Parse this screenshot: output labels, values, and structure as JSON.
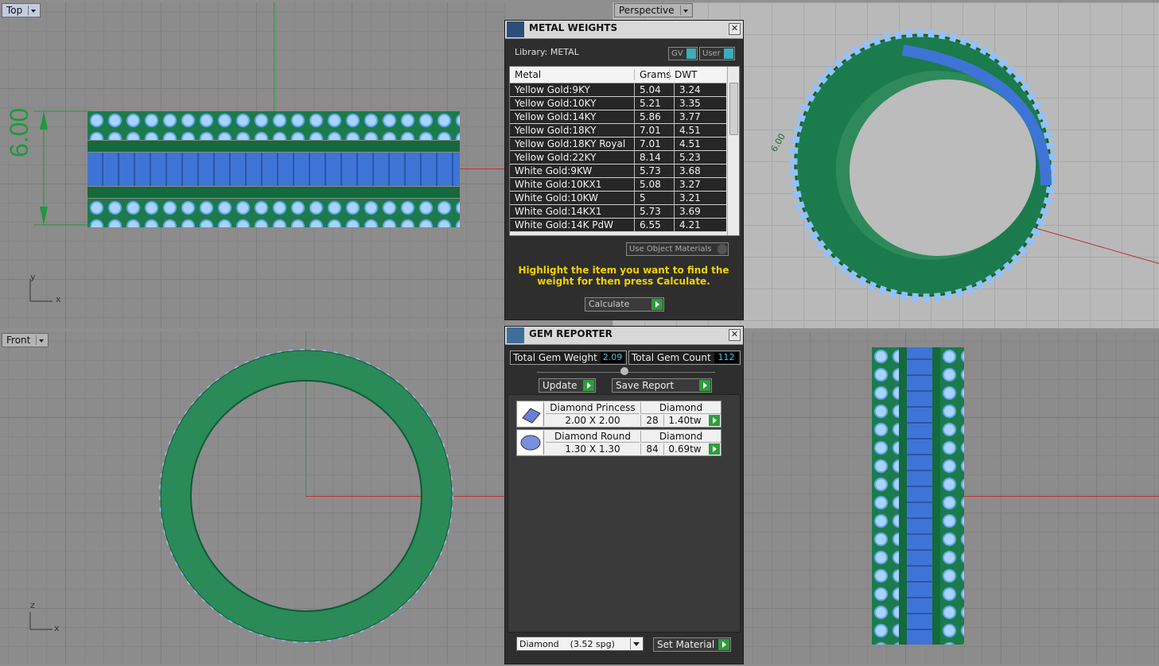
{
  "viewports": {
    "top": {
      "label": "Top",
      "dimension": "6.00",
      "axis_y": "y",
      "axis_x": "x"
    },
    "perspective": {
      "label": "Perspective",
      "dimension": "6.00"
    },
    "front": {
      "label": "Front",
      "axis_y": "z",
      "axis_x": "x"
    }
  },
  "metal_weights": {
    "title": "METAL WEIGHTS",
    "library": "Library: METAL",
    "gv_label": "GV",
    "user_label": "User",
    "columns": [
      "Metal",
      "Grams",
      "DWT"
    ],
    "rows": [
      {
        "metal": "Yellow Gold:9KY",
        "grams": "5.04",
        "dwt": "3.24"
      },
      {
        "metal": "Yellow Gold:10KY",
        "grams": "5.21",
        "dwt": "3.35"
      },
      {
        "metal": "Yellow Gold:14KY",
        "grams": "5.86",
        "dwt": "3.77"
      },
      {
        "metal": "Yellow Gold:18KY",
        "grams": "7.01",
        "dwt": "4.51"
      },
      {
        "metal": "Yellow Gold:18KY Royal",
        "grams": "7.01",
        "dwt": "4.51"
      },
      {
        "metal": "Yellow Gold:22KY",
        "grams": "8.14",
        "dwt": "5.23"
      },
      {
        "metal": "White Gold:9KW",
        "grams": "5.73",
        "dwt": "3.68"
      },
      {
        "metal": "White Gold:10KX1",
        "grams": "5.08",
        "dwt": "3.27"
      },
      {
        "metal": "White Gold:10KW",
        "grams": "5",
        "dwt": "3.21"
      },
      {
        "metal": "White Gold:14KX1",
        "grams": "5.73",
        "dwt": "3.69"
      },
      {
        "metal": "White Gold:14K PdW",
        "grams": "6.55",
        "dwt": "4.21"
      }
    ],
    "use_object_materials": "Use Object Materials",
    "hint": "Highlight the item you want to find the weight for then press Calculate.",
    "calculate": "Calculate"
  },
  "gem_reporter": {
    "title": "GEM REPORTER",
    "total_weight_label": "Total Gem Weight",
    "total_weight": "2.09",
    "total_count_label": "Total Gem Count",
    "total_count": "112",
    "update": "Update",
    "save_report": "Save Report",
    "gems": [
      {
        "name": "Diamond Princess",
        "material": "Diamond",
        "size": "2.00 X 2.00",
        "count": "28",
        "tw": "1.40tw"
      },
      {
        "name": "Diamond Round",
        "material": "Diamond",
        "size": "1.30 X 1.30",
        "count": "84",
        "tw": "0.69tw"
      }
    ],
    "material_select": "Diamond    (3.52 spg)",
    "set_material": "Set Material"
  },
  "colors": {
    "accent_green": "#2e9c3c",
    "hint_yellow": "#f2d200",
    "metal_green": "#1d7a4a",
    "gem_blue": "#6aa8f0"
  }
}
